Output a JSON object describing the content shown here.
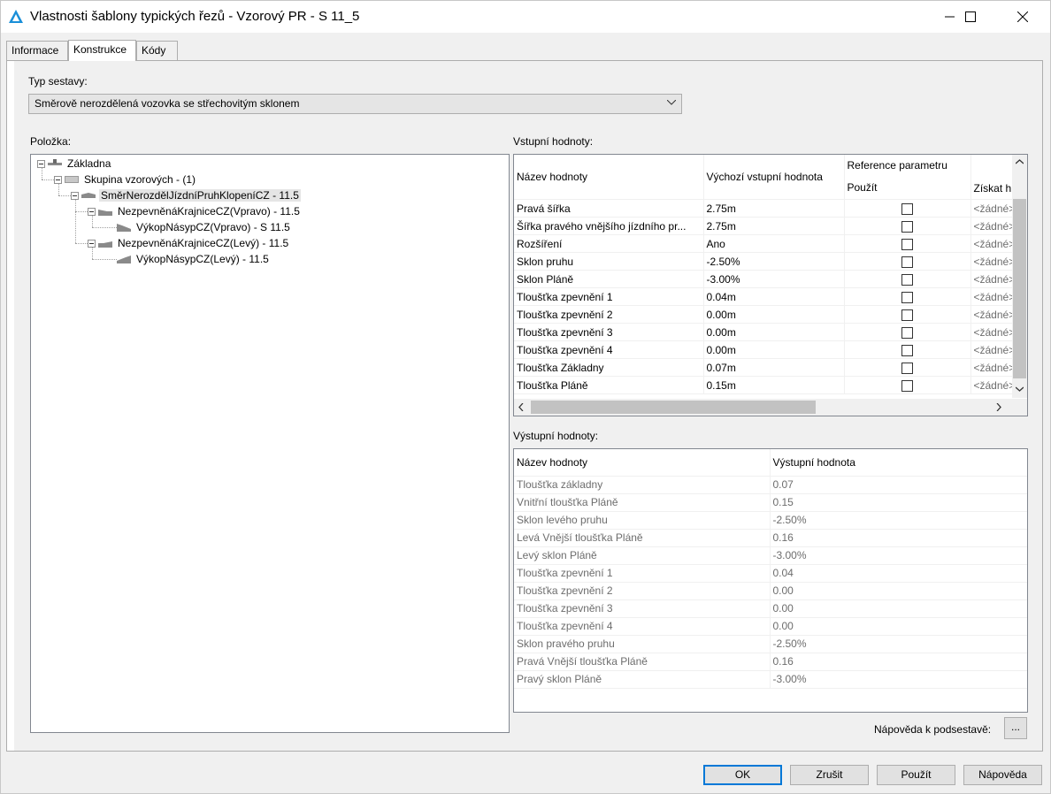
{
  "window": {
    "title": "Vlastnosti šablony typických řezů - Vzorový PR - S 11_5"
  },
  "tabs": [
    {
      "label": "Informace"
    },
    {
      "label": "Konstrukce"
    },
    {
      "label": "Kódy"
    }
  ],
  "assembly": {
    "type_label": "Typ sestavy:",
    "type_value": "Směrově nerozdělená vozovka se střechovitým sklonem"
  },
  "tree": {
    "label": "Položka:",
    "nodes": [
      {
        "text": "Základna"
      },
      {
        "text": "Skupina vzorových  - (1)"
      },
      {
        "text": "SměrNerozdělJízdníPruhKlopeníCZ - 11.5"
      },
      {
        "text": "NezpevněnáKrajniceCZ(Vpravo) - 11.5"
      },
      {
        "text": "VýkopNásypCZ(Vpravo) - S 11.5"
      },
      {
        "text": "NezpevněnáKrajniceCZ(Levý) - 11.5"
      },
      {
        "text": "VýkopNásypCZ(Levý) - 11.5"
      }
    ]
  },
  "input_values": {
    "label": "Vstupní hodnoty:",
    "columns": {
      "name": "Název hodnoty",
      "default": "Výchozí vstupní hodnota",
      "reference": "Reference parametru",
      "use": "Použít",
      "get": "Získat h"
    },
    "rows": [
      {
        "name": "Pravá šířka",
        "value": "2.75m",
        "ref": "<žádné>"
      },
      {
        "name": "Šířka pravého vnějšího jízdního pr...",
        "value": "2.75m",
        "ref": "<žádné>"
      },
      {
        "name": "Rozšíření",
        "value": "Ano",
        "ref": "<žádné>"
      },
      {
        "name": "Sklon pruhu",
        "value": "-2.50%",
        "ref": "<žádné>"
      },
      {
        "name": "Sklon Pláně",
        "value": "-3.00%",
        "ref": "<žádné>"
      },
      {
        "name": "Tloušťka zpevnění 1",
        "value": "0.04m",
        "ref": "<žádné>"
      },
      {
        "name": "Tloušťka zpevnění 2",
        "value": "0.00m",
        "ref": "<žádné>"
      },
      {
        "name": "Tloušťka zpevnění 3",
        "value": "0.00m",
        "ref": "<žádné>"
      },
      {
        "name": "Tloušťka zpevnění 4",
        "value": "0.00m",
        "ref": "<žádné>"
      },
      {
        "name": "Tloušťka Základny",
        "value": "0.07m",
        "ref": "<žádné>"
      },
      {
        "name": "Tloušťka Pláně",
        "value": "0.15m",
        "ref": "<žádné>"
      }
    ]
  },
  "output_values": {
    "label": "Výstupní hodnoty:",
    "columns": {
      "name": "Název hodnoty",
      "value": "Výstupní hodnota"
    },
    "rows": [
      {
        "name": "Tloušťka základny",
        "value": "0.07"
      },
      {
        "name": "Vnitřní tloušťka Pláně",
        "value": "0.15"
      },
      {
        "name": "Sklon levého pruhu",
        "value": "-2.50%"
      },
      {
        "name": "Levá Vnější tloušťka Pláně",
        "value": "0.16"
      },
      {
        "name": "Levý sklon Pláně",
        "value": "-3.00%"
      },
      {
        "name": "Tloušťka zpevnění 1",
        "value": "0.04"
      },
      {
        "name": "Tloušťka zpevnění 2",
        "value": "0.00"
      },
      {
        "name": "Tloušťka zpevnění 3",
        "value": "0.00"
      },
      {
        "name": "Tloušťka zpevnění 4",
        "value": "0.00"
      },
      {
        "name": "Sklon pravého pruhu",
        "value": "-2.50%"
      },
      {
        "name": "Pravá Vnější tloušťka Pláně",
        "value": "0.16"
      },
      {
        "name": "Pravý sklon Pláně",
        "value": "-3.00%"
      }
    ]
  },
  "subassembly_help": {
    "label": "Nápověda k podsestavě:",
    "button": "..."
  },
  "buttons": {
    "ok": "OK",
    "cancel": "Zrušit",
    "apply": "Použít",
    "help": "Nápověda"
  },
  "colors": {
    "accent": "#0078d7",
    "app_icon": "#1a8fd8",
    "disabled_text": "#6d6d6d"
  }
}
